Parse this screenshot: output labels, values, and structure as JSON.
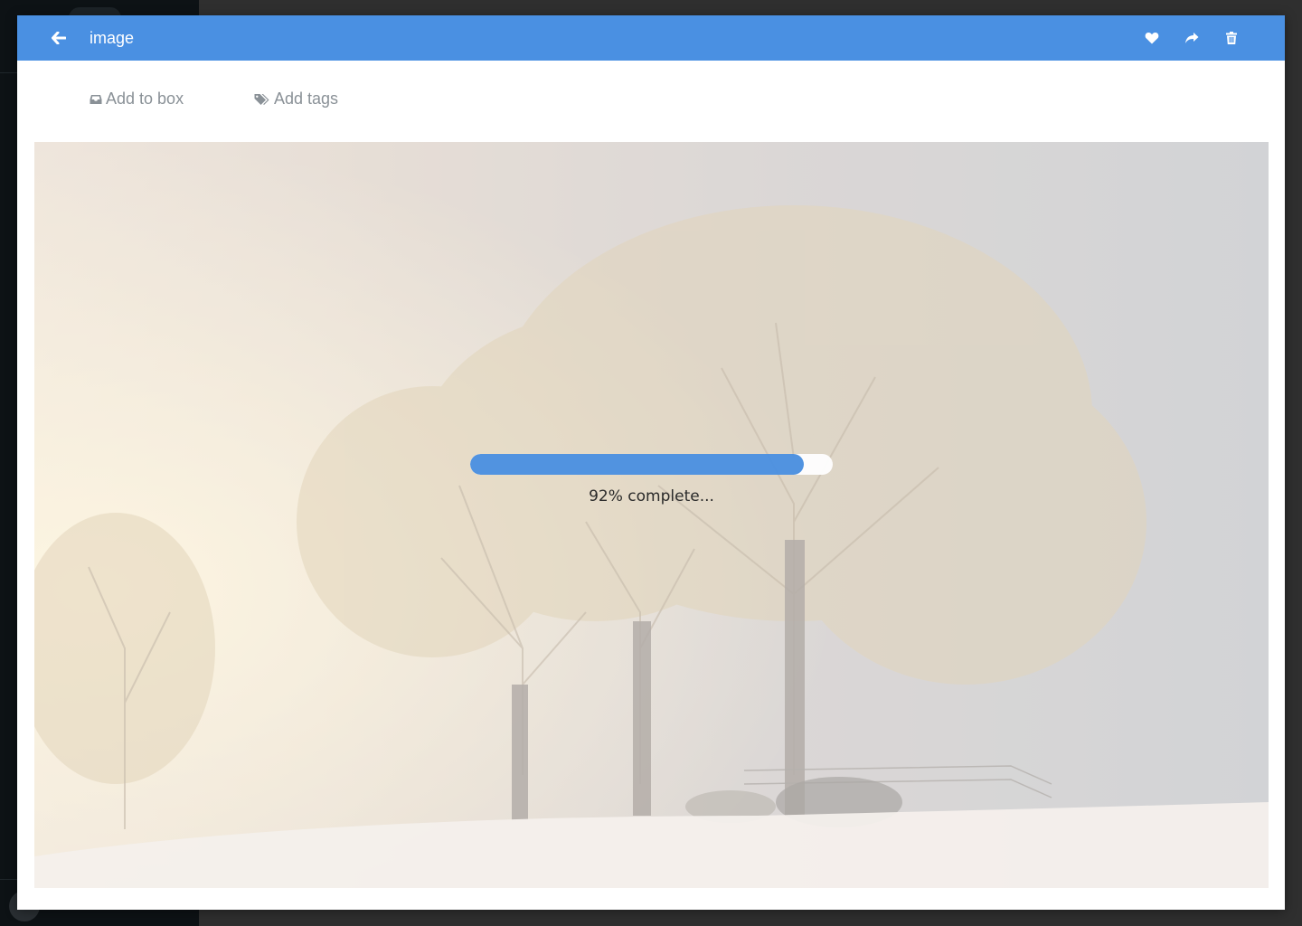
{
  "modal": {
    "title": "image",
    "header_color": "#4a90e2",
    "icons": {
      "back": "arrow-left-icon",
      "favorite": "heart-icon",
      "share": "share-icon",
      "delete": "trash-icon"
    }
  },
  "toolbar": {
    "add_to_box_label": "Add to box",
    "add_to_box_icon": "inbox-icon",
    "add_tags_label": "Add tags",
    "add_tags_icon": "tags-icon"
  },
  "upload": {
    "progress_percent": 92,
    "status_text": "92% complete...",
    "bar_color": "#4a90e2"
  }
}
